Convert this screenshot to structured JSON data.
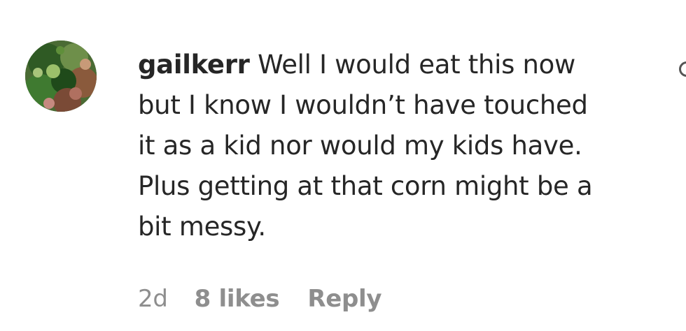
{
  "comment": {
    "username": "gailkerr",
    "text_lines": [
      "Well I would eat this now",
      "but I know I wouldn’t have touched",
      "it as a kid nor would my kids have.",
      "Plus getting at that corn might be a",
      "bit messy."
    ],
    "time": "2d",
    "likes": "8 likes",
    "reply_label": "Reply"
  },
  "icons": {
    "avatar": "user-avatar-photo",
    "edge_icon": "like-heart-icon"
  },
  "colors": {
    "text": "#262626",
    "meta": "#8e8e8e",
    "background": "#ffffff"
  }
}
